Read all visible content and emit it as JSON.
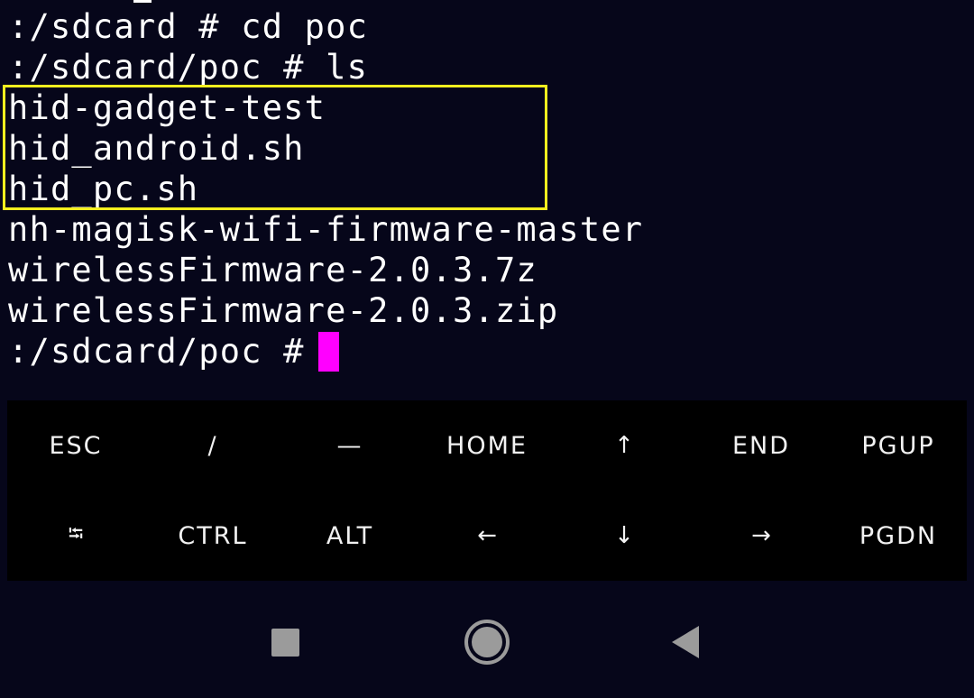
{
  "terminal": {
    "lines": [
      ":/sdcard # cd poc",
      ":/sdcard/poc # ls",
      "hid-gadget-test",
      "hid_android.sh",
      "hid_pc.sh",
      "nh-magisk-wifi-firmware-master",
      "wirelessFirmware-2.0.3.7z",
      "wirelessFirmware-2.0.3.zip",
      ":/sdcard/poc # "
    ],
    "highlight_color": "#f4ee1f",
    "cursor_color": "#ff00ff"
  },
  "extra_keys": {
    "row1": [
      "ESC",
      "/",
      "—",
      "HOME",
      "↑",
      "END",
      "PGUP"
    ],
    "row2": [
      "⭾",
      "CTRL",
      "ALT",
      "←",
      "↓",
      "→",
      "PGDN"
    ]
  },
  "navbar": {
    "icons": [
      "recents-icon",
      "home-icon",
      "back-icon"
    ],
    "icon_color": "#9b9b9b"
  }
}
